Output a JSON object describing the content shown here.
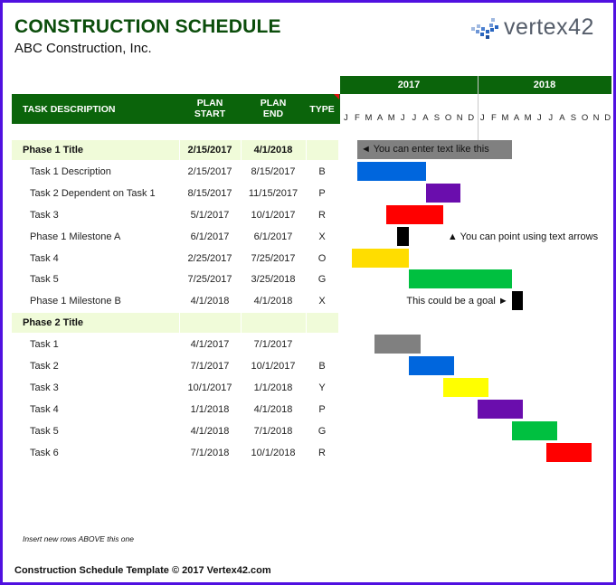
{
  "header": {
    "title": "CONSTRUCTION SCHEDULE",
    "subtitle": "ABC Construction, Inc.",
    "logo_text": "vertex42",
    "logo_icon": "vertex42-logo-icon"
  },
  "table_header": {
    "task_description": "TASK DESCRIPTION",
    "plan_start_line1": "PLAN",
    "plan_start_line2": "START",
    "plan_end_line1": "PLAN",
    "plan_end_line2": "END",
    "type": "TYPE"
  },
  "timeline": {
    "years": [
      "2017",
      "2018"
    ],
    "months": [
      "J",
      "F",
      "M",
      "A",
      "M",
      "J",
      "J",
      "A",
      "S",
      "O",
      "N",
      "D",
      "J",
      "F",
      "M",
      "A",
      "M",
      "J",
      "J",
      "A",
      "S",
      "O",
      "N",
      "D"
    ]
  },
  "type_colors": {
    "phase": "#808080",
    "B": "#0066dd",
    "P": "#6a0dad",
    "R": "#ff0000",
    "X": "#000000",
    "O": "#ffdd00",
    "G": "#00c040",
    "Y": "#ffff00",
    "none": "#808080"
  },
  "colors": {
    "header_green": "#0b640b",
    "title_green": "#0b4d0b",
    "phase_bg": "#f0fbd9",
    "frame": "#5010e0"
  },
  "rows": [
    {
      "kind": "phase",
      "desc": "Phase 1 Title",
      "start": "2/15/2017",
      "end": "4/1/2018",
      "type": "",
      "bar_start_month": 1.5,
      "bar_end_month": 15,
      "bar_label": "◄ You can enter text like this"
    },
    {
      "kind": "task",
      "desc": "Task 1 Description",
      "start": "2/15/2017",
      "end": "8/15/2017",
      "type": "B",
      "bar_start_month": 1.5,
      "bar_end_month": 7.5
    },
    {
      "kind": "task",
      "desc": "Task 2 Dependent on Task 1",
      "start": "8/15/2017",
      "end": "11/15/2017",
      "type": "P",
      "bar_start_month": 7.5,
      "bar_end_month": 10.5
    },
    {
      "kind": "task",
      "desc": "Task 3",
      "start": "5/1/2017",
      "end": "10/1/2017",
      "type": "R",
      "bar_start_month": 4,
      "bar_end_month": 9
    },
    {
      "kind": "milestone",
      "desc": "Phase 1 Milestone A",
      "start": "6/1/2017",
      "end": "6/1/2017",
      "type": "X",
      "bar_start_month": 5,
      "bar_end_month": 6,
      "annotation": "▲ You can point using text arrows",
      "annotation_side": "right"
    },
    {
      "kind": "task",
      "desc": "Task 4",
      "start": "2/25/2017",
      "end": "7/25/2017",
      "type": "O",
      "bar_start_month": 1,
      "bar_end_month": 6
    },
    {
      "kind": "task",
      "desc": "Task 5",
      "start": "7/25/2017",
      "end": "3/25/2018",
      "type": "G",
      "bar_start_month": 6,
      "bar_end_month": 15
    },
    {
      "kind": "milestone",
      "desc": "Phase 1 Milestone B",
      "start": "4/1/2018",
      "end": "4/1/2018",
      "type": "X",
      "bar_start_month": 15,
      "bar_end_month": 16,
      "annotation": "This could be a goal ►",
      "annotation_side": "left"
    },
    {
      "kind": "phase",
      "desc": "Phase 2 Title",
      "start": "",
      "end": "",
      "type": ""
    },
    {
      "kind": "task",
      "desc": "Task 1",
      "start": "4/1/2017",
      "end": "7/1/2017",
      "type": "",
      "bar_start_month": 3,
      "bar_end_month": 7
    },
    {
      "kind": "task",
      "desc": "Task 2",
      "start": "7/1/2017",
      "end": "10/1/2017",
      "type": "B",
      "bar_start_month": 6,
      "bar_end_month": 10
    },
    {
      "kind": "task",
      "desc": "Task 3",
      "start": "10/1/2017",
      "end": "1/1/2018",
      "type": "Y",
      "bar_start_month": 9,
      "bar_end_month": 13
    },
    {
      "kind": "task",
      "desc": "Task 4",
      "start": "1/1/2018",
      "end": "4/1/2018",
      "type": "P",
      "bar_start_month": 12,
      "bar_end_month": 16
    },
    {
      "kind": "task",
      "desc": "Task 5",
      "start": "4/1/2018",
      "end": "7/1/2018",
      "type": "G",
      "bar_start_month": 15,
      "bar_end_month": 19
    },
    {
      "kind": "task",
      "desc": "Task 6",
      "start": "7/1/2018",
      "end": "10/1/2018",
      "type": "R",
      "bar_start_month": 18,
      "bar_end_month": 22
    }
  ],
  "note": "Insert new rows ABOVE this one",
  "footer": "Construction Schedule Template © 2017 Vertex42.com"
}
